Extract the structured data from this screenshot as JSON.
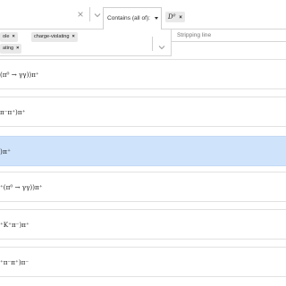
{
  "filter_bar": {
    "clear_symbol": "×",
    "contains_label": "Contains (all of):",
    "particle_tag": "D⁰",
    "tag_remove": "×"
  },
  "tags": [
    {
      "label": "ole",
      "remove": "×"
    },
    {
      "label": "charge-violating",
      "remove": "×"
    },
    {
      "label": "ating",
      "remove": "×"
    }
  ],
  "stripping_line": {
    "placeholder": "Stripping line"
  },
  "rows": [
    {
      "text": "(π⁰ → γγ))π⁺",
      "selected": false
    },
    {
      "text": "π⁻π⁺)π⁺",
      "selected": false
    },
    {
      "text": ")π⁺",
      "selected": true
    },
    {
      "text": "⁺(π⁰ → γγ))π⁺",
      "selected": false
    },
    {
      "text": "⁺K⁺π⁻)π⁺",
      "selected": false
    },
    {
      "text": "⁺π⁻π⁺)π⁻",
      "selected": false
    }
  ],
  "colors": {
    "selected_row": "#cfe3fb",
    "chip_bg": "#e9e9e9",
    "border": "#d6d6d6"
  }
}
